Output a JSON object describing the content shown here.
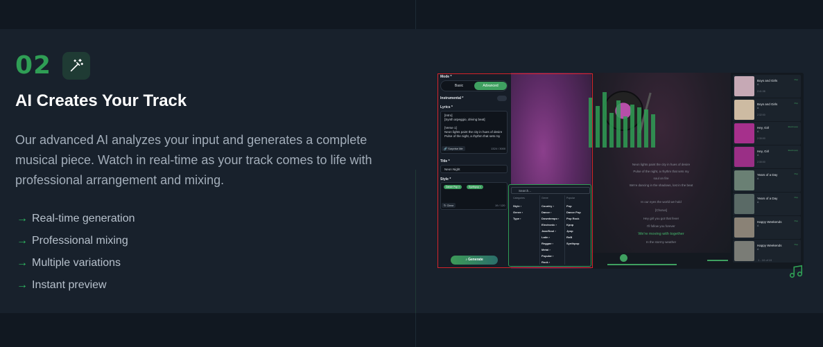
{
  "step": {
    "number": "02",
    "title": "AI Creates Your Track",
    "description": "Our advanced AI analyzes your input and generates a complete musical piece. Watch in real-time as your track comes to life with professional arrangement and mixing."
  },
  "features": [
    "Real-time generation",
    "Professional mixing",
    "Multiple variations",
    "Instant preview"
  ],
  "app": {
    "mode_label": "Mode *",
    "mode_basic": "Basic",
    "mode_advanced": "Advanced",
    "instrumental_label": "Instrumental *",
    "lyrics_label": "Lyrics *",
    "lyrics_lines": [
      "[Intro]",
      "[Synth arpeggio, driving beat]",
      "",
      "[Verse 1]",
      "Neon lights paint the city in hues of desire",
      "Pulse of the night, a rhythm that sets my"
    ],
    "surprise_label": "Surprise Me",
    "lyrics_count": "1324 / 3000",
    "title_label": "Title *",
    "title_value": "Neon Night",
    "style_label": "Style *",
    "style_chips": [
      "Dance Pop ×",
      "Synthpop ×"
    ],
    "clear_label": "Clear",
    "style_count": "19 / 120",
    "generate_label": "Generate",
    "search_placeholder": "Search...",
    "dd_categories_header": "Categories",
    "dd_categories": [
      "Style",
      "Genre",
      "Type"
    ],
    "dd_genre_header": "Genre",
    "dd_genres": [
      "Country",
      "Dance",
      "Downtempo",
      "Electronic",
      "Jazz/Soul",
      "Latin",
      "Reggae",
      "Metal",
      "Popular",
      "Rock"
    ],
    "dd_popular_header": "Popular",
    "dd_popular": [
      "Pop",
      "Dance Pop",
      "Pop Rock",
      "Kpop",
      "Jpop",
      "RnB",
      "Synthpop"
    ],
    "lyric_display": [
      "Neon lights paint the city in hues of desire",
      "Pulse of the night, a rhythm that sets my",
      "soul on fire",
      "We're dancing in the shadows, lost in the beat",
      "In our eyes the world we hold",
      "[Chorus]",
      "Hey girl you got that fever",
      "I'll follow you forever",
      "We're moving with together",
      "In the stormy weather"
    ],
    "highlight_line": "We're moving with together",
    "tracks": [
      {
        "title": "Boys and Girls",
        "artist": "A",
        "duration": "2:41:38",
        "tag": "Pop"
      },
      {
        "title": "Boys and Girls",
        "artist": "A",
        "duration": "2:32:00",
        "tag": "Pop"
      },
      {
        "title": "Hey, Girl",
        "artist": "A",
        "duration": "2:30:00",
        "tag": "Electropop"
      },
      {
        "title": "Hey, Girl",
        "artist": "A",
        "duration": "2:30:00",
        "tag": "Electropop"
      },
      {
        "title": "Years of a Day",
        "artist": "A",
        "duration": "",
        "tag": "Pop"
      },
      {
        "title": "Years of a Day",
        "artist": "A",
        "duration": "",
        "tag": "Pop"
      },
      {
        "title": "Happy Weekends",
        "artist": "A",
        "duration": "",
        "tag": "Pop"
      },
      {
        "title": "Happy Weekends",
        "artist": "A",
        "duration": "",
        "tag": "Pop"
      }
    ],
    "pager": "1 - 10 of 19",
    "progress": 1.0
  },
  "colors": {
    "accent": "#2f9e55",
    "highlight_box": "#d8242b"
  }
}
